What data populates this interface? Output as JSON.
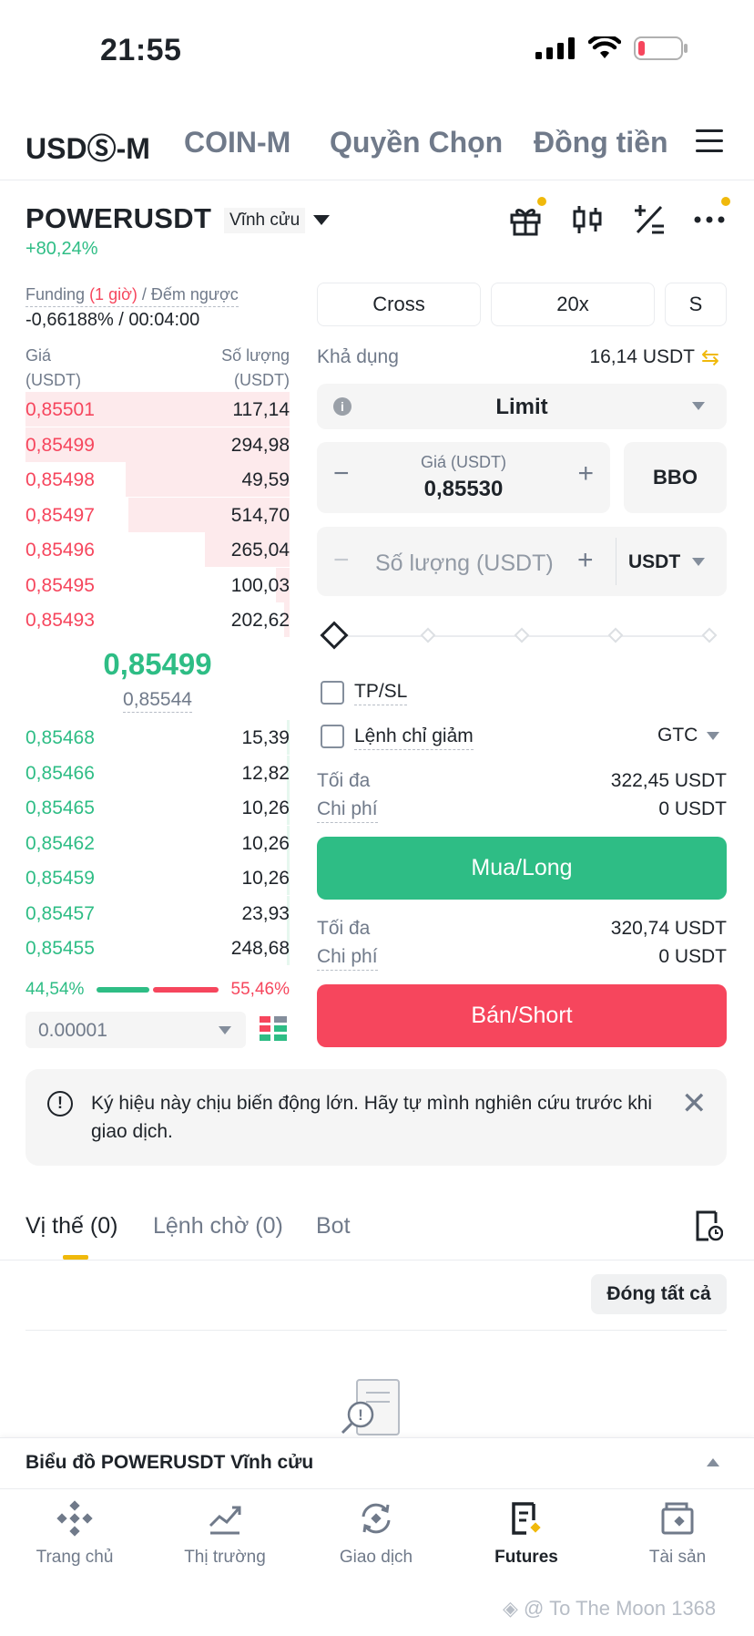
{
  "status_bar": {
    "time": "21:55"
  },
  "top_tabs": [
    "USDⓈ-M",
    "COIN-M",
    "Quyền Chọn",
    "Đồng tiền"
  ],
  "header": {
    "symbol": "POWERUSDT",
    "badge": "Vĩnh cửu",
    "change": "+80,24%"
  },
  "funding": {
    "label_prefix": "Funding ",
    "label_interval": "(1 giờ)",
    "label_suffix": " / Đếm ngược",
    "value": "-0,66188% / 00:04:00"
  },
  "orderbook": {
    "price_header": "Giá (USDT)",
    "qty_header": "Số lượng (USDT)",
    "asks": [
      {
        "price": "0,85501",
        "qty": "117,14",
        "depth": 1.0
      },
      {
        "price": "0,85499",
        "qty": "294,98",
        "depth": 1.0
      },
      {
        "price": "0,85498",
        "qty": "49,59",
        "depth": 0.62
      },
      {
        "price": "0,85497",
        "qty": "514,70",
        "depth": 0.61
      },
      {
        "price": "0,85496",
        "qty": "265,04",
        "depth": 0.32
      },
      {
        "price": "0,85495",
        "qty": "100,03",
        "depth": 0.05
      },
      {
        "price": "0,85493",
        "qty": "202,62",
        "depth": 0.02
      }
    ],
    "mid_price": "0,85499",
    "mark_price": "0,85544",
    "bids": [
      {
        "price": "0,85468",
        "qty": "15,39",
        "depth": 0.01
      },
      {
        "price": "0,85466",
        "qty": "12,82",
        "depth": 0.01
      },
      {
        "price": "0,85465",
        "qty": "10,26",
        "depth": 0.01
      },
      {
        "price": "0,85462",
        "qty": "10,26",
        "depth": 0.01
      },
      {
        "price": "0,85459",
        "qty": "10,26",
        "depth": 0.01
      },
      {
        "price": "0,85457",
        "qty": "23,93",
        "depth": 0.01
      },
      {
        "price": "0,85455",
        "qty": "248,68",
        "depth": 0.01
      }
    ],
    "buy_ratio": "44,54%",
    "sell_ratio": "55,46%",
    "tick_size": "0.00001"
  },
  "order_form": {
    "margin_mode": "Cross",
    "leverage": "20x",
    "asset_mode": "S",
    "available_label": "Khả dụng",
    "available_value": "16,14 USDT",
    "order_type": "Limit",
    "price_label": "Giá (USDT)",
    "price_value": "0,85530",
    "bbo_label": "BBO",
    "qty_placeholder": "Số lượng (USDT)",
    "qty_unit": "USDT",
    "slider_percent": 0,
    "tpsl_label": "TP/SL",
    "reduce_only_label": "Lệnh chỉ giảm",
    "time_in_force": "GTC",
    "buy_max_label": "Tối đa",
    "buy_max_value": "322,45 USDT",
    "buy_cost_label": "Chi phí",
    "buy_cost_value": "0 USDT",
    "buy_button": "Mua/Long",
    "sell_max_label": "Tối đa",
    "sell_max_value": "320,74 USDT",
    "sell_cost_label": "Chi phí",
    "sell_cost_value": "0 USDT",
    "sell_button": "Bán/Short"
  },
  "warning": {
    "text": "Ký hiệu này chịu biến động lớn. Hãy tự mình nghiên cứu trước khi giao dịch."
  },
  "positions": {
    "tabs": [
      "Vị thế (0)",
      "Lệnh chờ (0)",
      "Bot"
    ],
    "close_all": "Đóng tất cả"
  },
  "chart_bar": {
    "label": "Biểu đồ POWERUSDT Vĩnh cửu"
  },
  "nav": {
    "items": [
      "Trang chủ",
      "Thị trường",
      "Giao dịch",
      "Futures",
      "Tài sản"
    ]
  },
  "watermark": "To The Moon 1368",
  "colors": {
    "green": "#2ebd85",
    "red": "#f6465d",
    "accent": "#f0b90b"
  }
}
